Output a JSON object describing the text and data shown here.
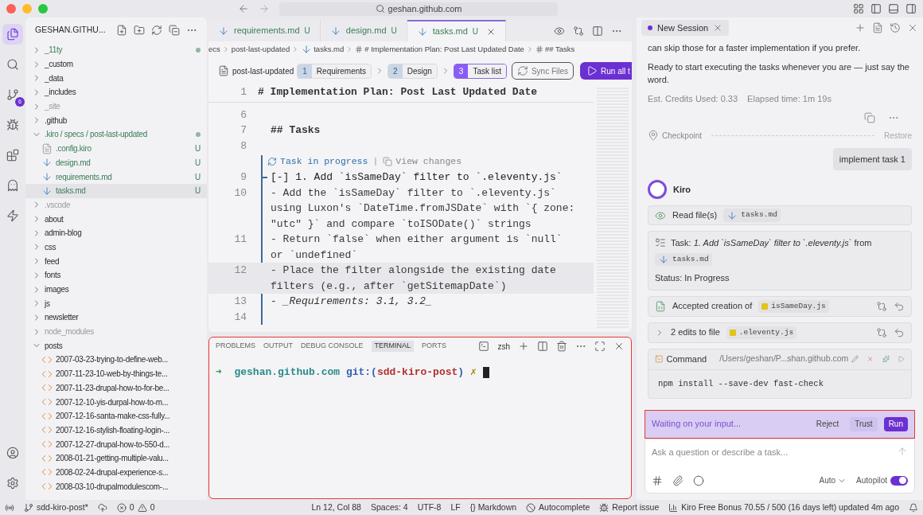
{
  "window": {
    "title": "geshan.github.com"
  },
  "activity_bar": {
    "items": [
      {
        "kind": "files",
        "selected": true
      },
      {
        "kind": "search",
        "selected": false
      },
      {
        "kind": "source-control",
        "selected": false,
        "badge": "6"
      },
      {
        "kind": "debug",
        "selected": false
      },
      {
        "kind": "extensions",
        "selected": false
      },
      {
        "kind": "kiro",
        "selected": false
      },
      {
        "kind": "mcp",
        "selected": false
      }
    ],
    "bottom": [
      {
        "kind": "account"
      },
      {
        "kind": "settings"
      }
    ]
  },
  "explorer": {
    "title": "GESHAN.GITHU...",
    "items": [
      {
        "label": "_11ty",
        "kind": "folder",
        "expanded": false,
        "untracked": true,
        "ignored": false,
        "dot": true,
        "selected": false
      },
      {
        "label": "_custom",
        "kind": "folder",
        "expanded": false,
        "untracked": false,
        "ignored": false,
        "dot": false,
        "selected": false
      },
      {
        "label": "_data",
        "kind": "folder",
        "expanded": false,
        "untracked": false,
        "ignored": false,
        "dot": false,
        "selected": false
      },
      {
        "label": "_includes",
        "kind": "folder",
        "expanded": false,
        "untracked": false,
        "ignored": false,
        "dot": false,
        "selected": false
      },
      {
        "label": "_site",
        "kind": "folder",
        "expanded": false,
        "untracked": false,
        "ignored": true,
        "dot": false,
        "selected": false
      },
      {
        "label": ".github",
        "kind": "folder",
        "expanded": false,
        "untracked": false,
        "ignored": false,
        "dot": false,
        "selected": false
      },
      {
        "label": ".kiro / specs / post-last-updated",
        "kind": "folder",
        "expanded": true,
        "untracked": true,
        "ignored": false,
        "dot": true,
        "selected": false,
        "children": [
          {
            "label": ".config.kiro",
            "kind": "config",
            "untracked": true,
            "ignored": false,
            "dot": false,
            "badge": "U",
            "selected": false
          },
          {
            "label": "design.md",
            "kind": "markdown",
            "untracked": true,
            "ignored": false,
            "dot": false,
            "badge": "U",
            "selected": false
          },
          {
            "label": "requirements.md",
            "kind": "markdown",
            "untracked": true,
            "ignored": false,
            "dot": false,
            "badge": "U",
            "selected": false
          },
          {
            "label": "tasks.md",
            "kind": "markdown",
            "untracked": true,
            "ignored": false,
            "dot": false,
            "badge": "U",
            "selected": true
          }
        ]
      },
      {
        "label": ".vscode",
        "kind": "folder",
        "expanded": false,
        "untracked": false,
        "ignored": true,
        "dot": false,
        "selected": false
      },
      {
        "label": "about",
        "kind": "folder",
        "expanded": false,
        "untracked": false,
        "ignored": false,
        "dot": false,
        "selected": false
      },
      {
        "label": "admin-blog",
        "kind": "folder",
        "expanded": false,
        "untracked": false,
        "ignored": false,
        "dot": false,
        "selected": false
      },
      {
        "label": "css",
        "kind": "folder",
        "expanded": false,
        "untracked": false,
        "ignored": false,
        "dot": false,
        "selected": false
      },
      {
        "label": "feed",
        "kind": "folder",
        "expanded": false,
        "untracked": false,
        "ignored": false,
        "dot": false,
        "selected": false
      },
      {
        "label": "fonts",
        "kind": "folder",
        "expanded": false,
        "untracked": false,
        "ignored": false,
        "dot": false,
        "selected": false
      },
      {
        "label": "images",
        "kind": "folder",
        "expanded": false,
        "untracked": false,
        "ignored": false,
        "dot": false,
        "selected": false
      },
      {
        "label": "js",
        "kind": "folder",
        "expanded": false,
        "untracked": false,
        "ignored": false,
        "dot": false,
        "selected": false
      },
      {
        "label": "newsletter",
        "kind": "folder",
        "expanded": false,
        "untracked": false,
        "ignored": false,
        "dot": false,
        "selected": false
      },
      {
        "label": "node_modules",
        "kind": "folder",
        "expanded": false,
        "untracked": false,
        "ignored": true,
        "dot": false,
        "selected": false
      },
      {
        "label": "posts",
        "kind": "folder",
        "expanded": true,
        "untracked": false,
        "ignored": false,
        "dot": false,
        "selected": false,
        "children": [
          {
            "label": "2007-03-23-trying-to-define-web...",
            "kind": "html",
            "untracked": false,
            "ignored": false,
            "dot": false,
            "selected": false
          },
          {
            "label": "2007-11-23-10-web-by-things-te...",
            "kind": "html",
            "untracked": false,
            "ignored": false,
            "dot": false,
            "selected": false
          },
          {
            "label": "2007-11-23-drupal-how-to-for-be...",
            "kind": "html",
            "untracked": false,
            "ignored": false,
            "dot": false,
            "selected": false
          },
          {
            "label": "2007-12-10-yis-durpal-how-to-m...",
            "kind": "html",
            "untracked": false,
            "ignored": false,
            "dot": false,
            "selected": false
          },
          {
            "label": "2007-12-16-santa-make-css-fully...",
            "kind": "html",
            "untracked": false,
            "ignored": false,
            "dot": false,
            "selected": false
          },
          {
            "label": "2007-12-16-stylish-floating-login-...",
            "kind": "html",
            "untracked": false,
            "ignored": false,
            "dot": false,
            "selected": false
          },
          {
            "label": "2007-12-27-drupal-how-to-550-d...",
            "kind": "html",
            "untracked": false,
            "ignored": false,
            "dot": false,
            "selected": false
          },
          {
            "label": "2008-01-21-getting-multiple-valu...",
            "kind": "html",
            "untracked": false,
            "ignored": false,
            "dot": false,
            "selected": false
          },
          {
            "label": "2008-02-24-drupal-experience-s...",
            "kind": "html",
            "untracked": false,
            "ignored": false,
            "dot": false,
            "selected": false
          },
          {
            "label": "2008-03-10-drupalmodulescom-...",
            "kind": "html",
            "untracked": false,
            "ignored": false,
            "dot": false,
            "selected": false
          }
        ]
      }
    ]
  },
  "editor_tabs": [
    {
      "label": "requirements.md",
      "badge": "U",
      "selected": false
    },
    {
      "label": "design.md",
      "badge": "U",
      "selected": false
    },
    {
      "label": "tasks.md",
      "badge": "U",
      "selected": true
    }
  ],
  "breadcrumb": [
    {
      "label": "ecs",
      "kind": "folder"
    },
    {
      "label": "post-last-updated",
      "kind": "folder"
    },
    {
      "label": "tasks.md",
      "kind": "markdown"
    },
    {
      "label": "# Implementation Plan: Post Last Updated Date",
      "kind": "symbol"
    },
    {
      "label": "## Tasks",
      "kind": "symbol"
    }
  ],
  "spec_bar": {
    "name": "post-last-updated",
    "steps": [
      {
        "number": "1",
        "label": "Requirements",
        "selected": false
      },
      {
        "number": "2",
        "label": "Design",
        "selected": false
      },
      {
        "number": "3",
        "label": "Task list",
        "selected": true
      }
    ],
    "sync": "Sync Files",
    "run": "Run all t"
  },
  "editor": {
    "sticky": {
      "number": "1",
      "text": "# Implementation Plan: Post Last Updated Date"
    },
    "lines": [
      {
        "number": "6",
        "kind": "blank",
        "current": false
      },
      {
        "number": "7",
        "kind": "heading",
        "text": "## Tasks",
        "current": false
      },
      {
        "number": "8",
        "kind": "blank",
        "current": false
      }
    ],
    "task_block": {
      "status": "Task in progress",
      "separator": "|",
      "action": "View changes",
      "lines": [
        {
          "number": "9",
          "kind": "task",
          "text": "[-] 1. Add `isSameDay` filter to `.eleventy.js`",
          "current": false
        },
        {
          "number": "10",
          "kind": "bullet",
          "text": "- Add the `isSameDay` filter to `.eleventy.js` using Luxon's `DateTime.fromJSDate` with `{ zone: \"utc\" }` and compare `toISODate()` strings",
          "current": false
        },
        {
          "number": "11",
          "kind": "bullet",
          "text": "- Return `false` when either argument is `null` or `undefined`",
          "current": false
        },
        {
          "number": "12",
          "kind": "bullet",
          "text": "- Place the filter alongside the existing date filters (e.g., after `getSitemapDate`)",
          "current": true
        },
        {
          "number": "13",
          "kind": "requirement",
          "text": "- *_Requirements: 3.1, 3.2_*",
          "current": false
        },
        {
          "number": "14",
          "kind": "blank",
          "current": false
        }
      ]
    }
  },
  "terminal": {
    "tabs": [
      {
        "label": "PROBLEMS",
        "selected": false
      },
      {
        "label": "OUTPUT",
        "selected": false
      },
      {
        "label": "DEBUG CONSOLE",
        "selected": false
      },
      {
        "label": "TERMINAL",
        "selected": true
      },
      {
        "label": "PORTS",
        "selected": false
      }
    ],
    "shell": "zsh",
    "prompt": {
      "arrow": "➜",
      "dir": "geshan.github.com",
      "git_open": "git:(",
      "branch": "sdd-kiro-post",
      "git_close": ")",
      "dirty": "✗"
    }
  },
  "chat": {
    "session_tab": "New Session",
    "paragraphs": [
      "can skip those for a faster implementation if you prefer.",
      "Ready to start executing the tasks whenever you are — just say the word."
    ],
    "meta": [
      "Est. Credits Used: 0.33",
      "Elapsed time: 1m 19s"
    ],
    "checkpoint": {
      "label": "Checkpoint",
      "action": "Restore"
    },
    "user_message": "implement task 1",
    "agent": "Kiro",
    "steps": [
      {
        "kind": "read",
        "label": "Read file(s)",
        "file": {
          "name": "tasks.md",
          "kind": "markdown"
        }
      },
      {
        "kind": "task",
        "label": "Task: *1. Add `isSameDay` filter to `.eleventy.js`* from",
        "file": {
          "name": "tasks.md",
          "kind": "markdown"
        },
        "status": "Status: In Progress"
      },
      {
        "kind": "created",
        "label": "Accepted creation of",
        "file": {
          "name": "isSameDay.js",
          "kind": "script"
        }
      },
      {
        "kind": "edits",
        "label": "2 edits to file",
        "file": {
          "name": ".eleventy.js",
          "kind": "script"
        },
        "expanded": false
      },
      {
        "kind": "command",
        "label": "Command",
        "path": "/Users/geshan/P...shan.github.com",
        "command": "npm install --save-dev fast-check"
      }
    ],
    "prompt": {
      "text": "Waiting on your input...",
      "actions": [
        {
          "label": "Reject",
          "kind": "plain"
        },
        {
          "label": "Trust",
          "kind": "secondary"
        },
        {
          "label": "Run",
          "kind": "primary"
        }
      ]
    },
    "input": {
      "placeholder": "Ask a question or describe a task...",
      "mode": "Auto",
      "autopilot_label": "Autopilot",
      "autopilot": true
    }
  },
  "status_bar": {
    "branch": "sdd-kiro-post*",
    "errors": "0",
    "warnings": "0",
    "items": [
      "Ln 12, Col 88",
      "Spaces: 4",
      "UTF-8",
      "LF"
    ],
    "language_icon": "{}",
    "language": "Markdown",
    "autocomplete": "Autocomplete",
    "report": "Report issue",
    "bonus": "Kiro Free Bonus 70.55 / 500 (16 days left) updated 4m ago"
  }
}
